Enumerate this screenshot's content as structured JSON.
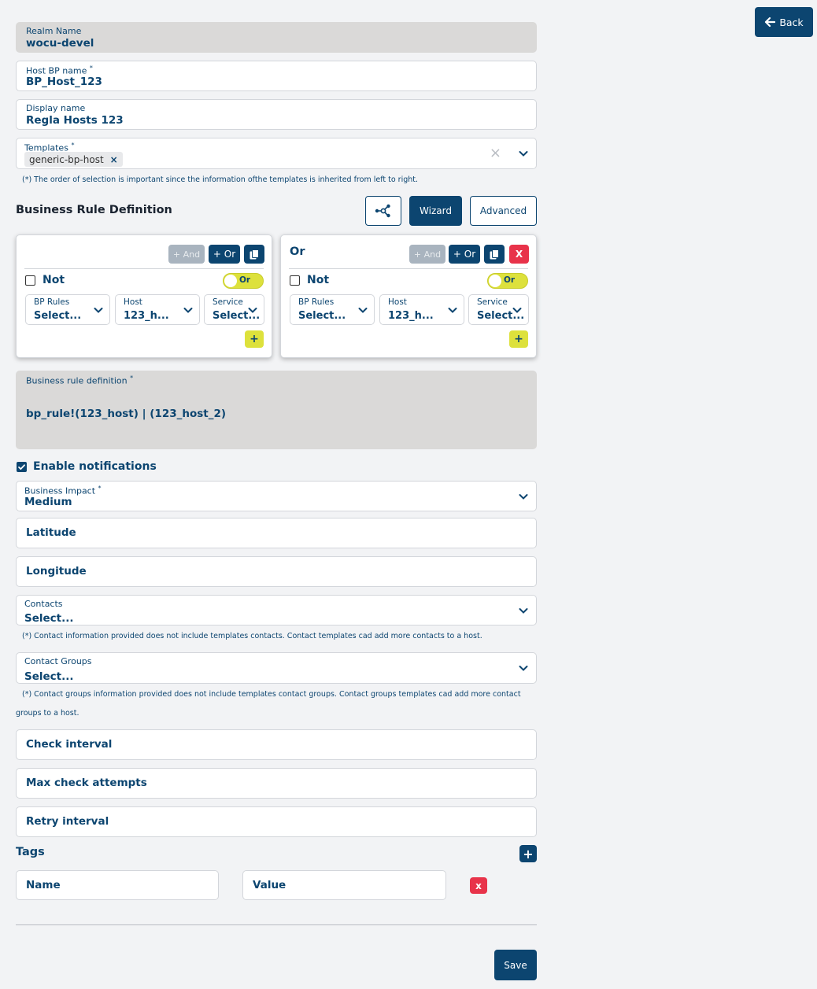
{
  "header": {
    "back_label": "Back"
  },
  "fields": {
    "realm_name": {
      "label": "Realm Name",
      "value": "wocu-devel"
    },
    "host_bp_name": {
      "label": "Host BP name",
      "required": "*",
      "value": "BP_Host_123"
    },
    "display_name": {
      "label": "Display name",
      "value": "Regla Hosts 123"
    },
    "templates": {
      "label": "Templates",
      "required": "*",
      "chip": "generic-bp-host",
      "chip_remove": "×",
      "clear": "×"
    },
    "templates_note": "(*) The order of selection is important since the information ofthe templates is inherited from left to right."
  },
  "business_rule": {
    "title": "Business Rule Definition",
    "wizard_label": "Wizard",
    "advanced_label": "Advanced",
    "cards": [
      {
        "heading": "",
        "and_label": "+ And",
        "or_label": "+ Or",
        "not_label": "Not",
        "toggle_label": "Or",
        "selects": [
          {
            "label": "BP Rules",
            "value": "Select..."
          },
          {
            "label": "Host",
            "value": "123_h..."
          },
          {
            "label": "Service",
            "value": "Select..."
          }
        ],
        "add_label": "+"
      },
      {
        "heading": "Or",
        "and_label": "+ And",
        "or_label": "+ Or",
        "remove_label": "X",
        "not_label": "Not",
        "toggle_label": "Or",
        "selects": [
          {
            "label": "BP Rules",
            "value": "Select..."
          },
          {
            "label": "Host",
            "value": "123_h..."
          },
          {
            "label": "Service",
            "value": "Select..."
          }
        ],
        "add_label": "+"
      }
    ],
    "definition_label": "Business rule definition",
    "definition_required": "*",
    "definition_value": "bp_rule!(123_host) | (123_host_2)"
  },
  "notifications": {
    "label": "Enable notifications",
    "checked": true
  },
  "business_impact": {
    "label": "Business Impact",
    "required": "*",
    "value": "Medium"
  },
  "latitude_placeholder": "Latitude",
  "longitude_placeholder": "Longitude",
  "contacts": {
    "label": "Contacts",
    "value": "Select...",
    "note": "(*) Contact information provided does not include templates contacts. Contact templates cad add more contacts to a host."
  },
  "contact_groups": {
    "label": "Contact Groups",
    "value": "Select...",
    "note_line1": "(*) Contact groups information provided does not include templates contact groups. Contact groups templates cad add more contact",
    "note_line2": "groups to a host."
  },
  "check_interval_placeholder": "Check interval",
  "max_check_attempts_placeholder": "Max check attempts",
  "retry_interval_placeholder": "Retry interval",
  "tags": {
    "title": "Tags",
    "add_label": "+",
    "name_placeholder": "Name",
    "value_placeholder": "Value",
    "remove_label": "x"
  },
  "save_label": "Save",
  "colors": {
    "primary": "#0c4570",
    "accent_yellow": "#dde13c",
    "danger": "#e8334a",
    "disabled_field": "#dad9d8"
  }
}
